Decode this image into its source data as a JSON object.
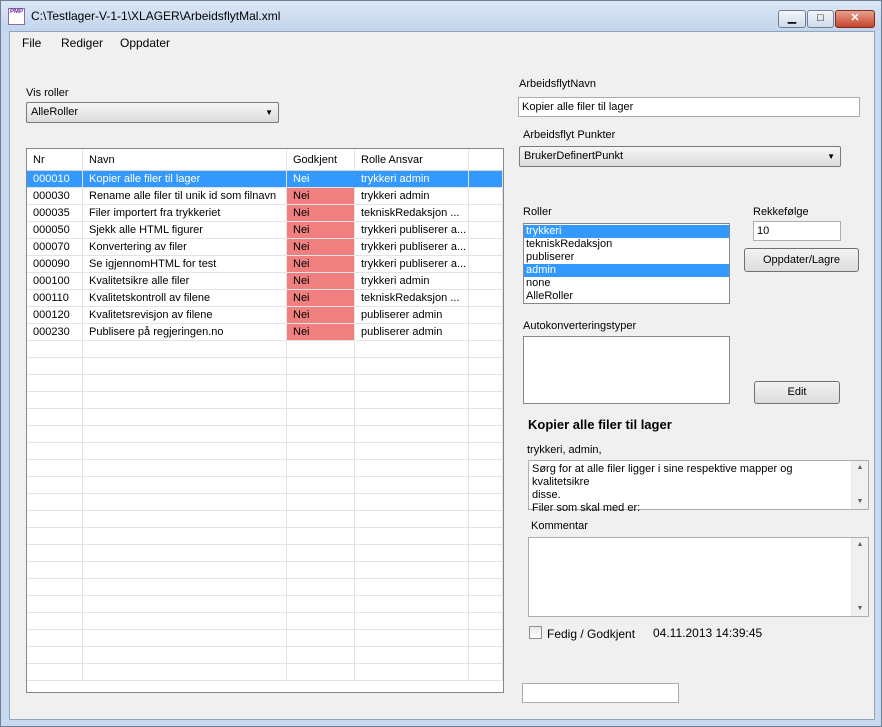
{
  "window": {
    "title": "C:\\Testlager-V-1-1\\XLAGER\\ArbeidsflytMal.xml",
    "icon_text": "PMP",
    "minimize": "▁",
    "maximize": "□",
    "close": "✕"
  },
  "menu": {
    "file": "File",
    "rediger": "Rediger",
    "oppdater": "Oppdater"
  },
  "vis_roller": {
    "label": "Vis roller",
    "selected": "AlleRoller"
  },
  "grid": {
    "columns": [
      "Nr",
      "Navn",
      "Godkjent",
      "Rolle Ansvar"
    ],
    "rows": [
      {
        "nr": "000010",
        "navn": "Kopier alle filer til lager",
        "godkjent": "Nei",
        "rolle": "trykkeri admin"
      },
      {
        "nr": "000030",
        "navn": "Rename alle filer til unik id som filnavn",
        "godkjent": "Nei",
        "rolle": "trykkeri admin"
      },
      {
        "nr": "000035",
        "navn": "Filer importert fra trykkeriet",
        "godkjent": "Nei",
        "rolle": "tekniskRedaksjon ..."
      },
      {
        "nr": "000050",
        "navn": "Sjekk alle HTML figurer",
        "godkjent": "Nei",
        "rolle": "trykkeri publiserer a..."
      },
      {
        "nr": "000070",
        "navn": "Konvertering av filer",
        "godkjent": "Nei",
        "rolle": "trykkeri publiserer a..."
      },
      {
        "nr": "000090",
        "navn": "Se igjennomHTML for test",
        "godkjent": "Nei",
        "rolle": "trykkeri publiserer a..."
      },
      {
        "nr": "000100",
        "navn": "Kvalitetsikre alle filer",
        "godkjent": "Nei",
        "rolle": "trykkeri admin"
      },
      {
        "nr": "000110",
        "navn": "Kvalitetskontroll av filene",
        "godkjent": "Nei",
        "rolle": "tekniskRedaksjon ..."
      },
      {
        "nr": "000120",
        "navn": "Kvalitetsrevisjon av filene",
        "godkjent": "Nei",
        "rolle": "publiserer admin"
      },
      {
        "nr": "000230",
        "navn": "Publisere på regjeringen.no",
        "godkjent": "Nei",
        "rolle": "publiserer admin"
      }
    ]
  },
  "arbeidsflyt_navn": {
    "label": "ArbeidsflytNavn",
    "value": "Kopier alle filer til lager"
  },
  "arbeidsflyt_punkter": {
    "label": "Arbeidsflyt Punkter",
    "selected": "BrukerDefinertPunkt"
  },
  "roller": {
    "label": "Roller",
    "items": [
      {
        "label": "trykkeri",
        "selected": true
      },
      {
        "label": "tekniskRedaksjon",
        "selected": false
      },
      {
        "label": "publiserer",
        "selected": false
      },
      {
        "label": "admin",
        "selected": true
      },
      {
        "label": "none",
        "selected": false
      },
      {
        "label": "AlleRoller",
        "selected": false
      }
    ]
  },
  "rekkefolge": {
    "label": "Rekkefølge",
    "value": "10"
  },
  "buttons": {
    "oppdater_lagre": "Oppdater/Lagre",
    "edit": "Edit"
  },
  "autokonvertering": {
    "label": "Autokonverteringstyper"
  },
  "detail": {
    "title": "Kopier alle filer til lager",
    "roles": "trykkeri, admin,",
    "description_lines": [
      "Sørg for at alle filer ligger i sine respektive mapper og kvalitetsikre",
      "disse.",
      "Filer som skal med er:"
    ]
  },
  "kommentar": {
    "label": "Kommentar",
    "value": ""
  },
  "ferdig": {
    "label": "Fedig / Godkjent",
    "checked": false,
    "timestamp": "04.11.2013 14:39:45"
  },
  "bottom_field": {
    "value": ""
  }
}
